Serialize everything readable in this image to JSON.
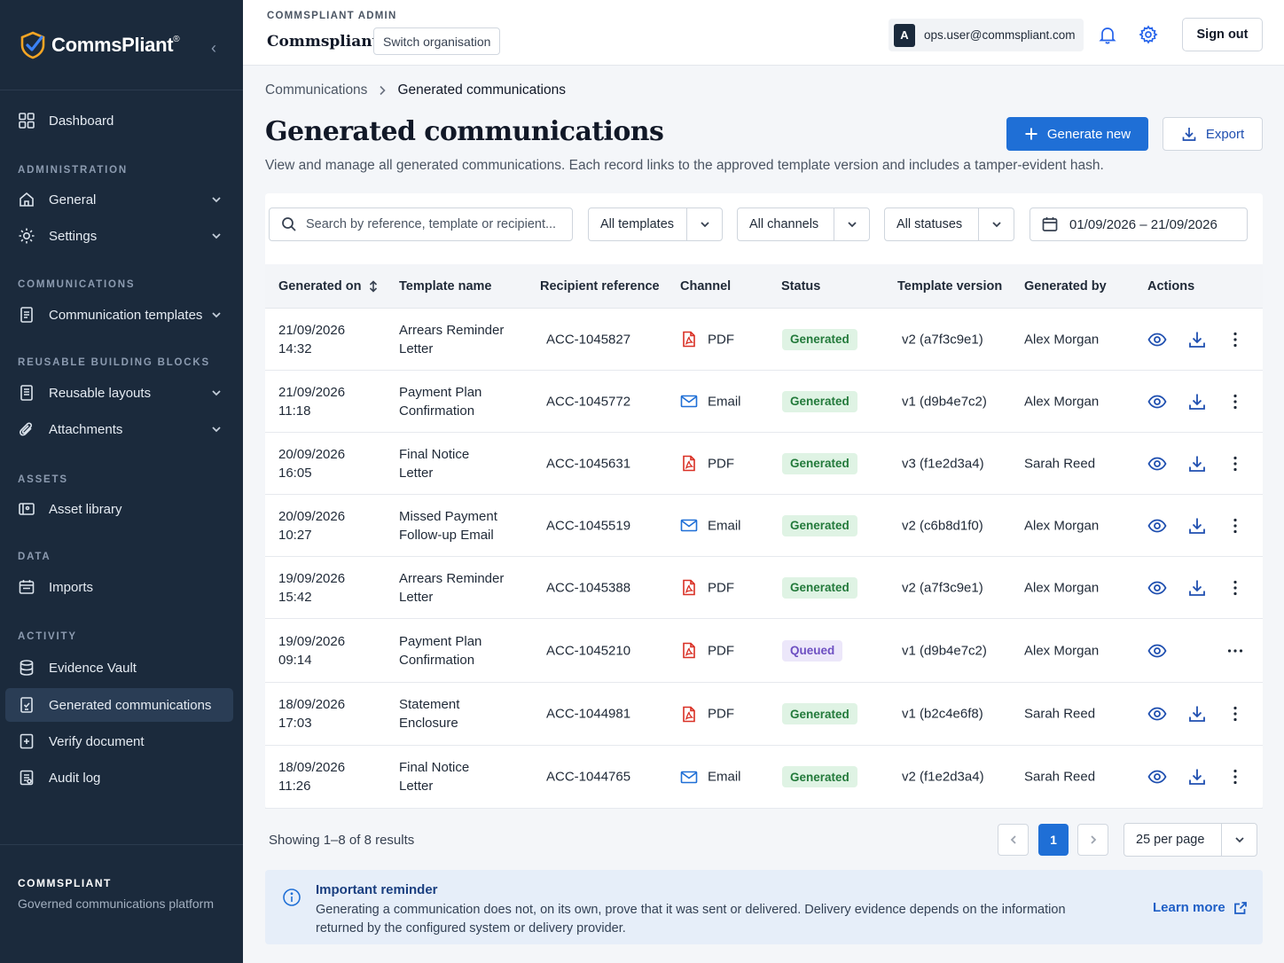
{
  "brand": {
    "name": "CommsPliant",
    "registered": "®"
  },
  "sidebar": {
    "dashboard": "Dashboard",
    "sections": {
      "administration": "ADMINISTRATION",
      "communications": "COMMUNICATIONS",
      "building_blocks": "REUSABLE BUILDING BLOCKS",
      "assets": "ASSETS",
      "data": "DATA",
      "activity": "ACTIVITY"
    },
    "items": {
      "general": "General",
      "settings": "Settings",
      "templates": "Communication templates",
      "layouts": "Reusable layouts",
      "attachments": "Attachments",
      "asset_library": "Asset library",
      "imports": "Imports",
      "evidence_vault": "Evidence Vault",
      "generated": "Generated communications",
      "verify": "Verify document",
      "audit": "Audit log"
    },
    "footer": {
      "title": "COMMSPLIANT",
      "subtitle": "Governed communications platform"
    }
  },
  "header": {
    "admin_label": "COMMSPLIANT ADMIN",
    "org_name": "Commspliant",
    "switch_org": "Switch organisation",
    "user_initial": "A",
    "user_email": "ops.user@commspliant.com",
    "sign_out": "Sign out"
  },
  "breadcrumb": {
    "parent": "Communications",
    "current": "Generated communications"
  },
  "page": {
    "title": "Generated communications",
    "subtitle": "View and manage all generated communications. Each record links to the approved template version and includes a tamper-evident hash.",
    "generate_new": "Generate new",
    "export": "Export"
  },
  "filters": {
    "search_placeholder": "Search by reference, template or recipient...",
    "templates": "All templates",
    "channels": "All channels",
    "statuses": "All statuses",
    "date_range": "01/09/2026 – 21/09/2026"
  },
  "table": {
    "columns": [
      "Generated on",
      "Template name",
      "Recipient reference",
      "Channel",
      "Status",
      "Template version",
      "Generated by",
      "Actions"
    ],
    "rows": [
      {
        "date": "21/09/2026",
        "time": "14:32",
        "t1": "Arrears Reminder",
        "t2": "Letter",
        "ref": "ACC-1045827",
        "channel": "PDF",
        "status": "Generated",
        "version": "v2 (a7f3c9e1)",
        "by": "Alex Morgan"
      },
      {
        "date": "21/09/2026",
        "time": "11:18",
        "t1": "Payment Plan",
        "t2": "Confirmation",
        "ref": "ACC-1045772",
        "channel": "Email",
        "status": "Generated",
        "version": "v1 (d9b4e7c2)",
        "by": "Alex Morgan"
      },
      {
        "date": "20/09/2026",
        "time": "16:05",
        "t1": "Final Notice",
        "t2": "Letter",
        "ref": "ACC-1045631",
        "channel": "PDF",
        "status": "Generated",
        "version": "v3 (f1e2d3a4)",
        "by": "Sarah Reed"
      },
      {
        "date": "20/09/2026",
        "time": "10:27",
        "t1": "Missed Payment",
        "t2": "Follow-up Email",
        "ref": "ACC-1045519",
        "channel": "Email",
        "status": "Generated",
        "version": "v2 (c6b8d1f0)",
        "by": "Alex Morgan"
      },
      {
        "date": "19/09/2026",
        "time": "15:42",
        "t1": "Arrears Reminder",
        "t2": "Letter",
        "ref": "ACC-1045388",
        "channel": "PDF",
        "status": "Generated",
        "version": "v2 (a7f3c9e1)",
        "by": "Alex Morgan"
      },
      {
        "date": "19/09/2026",
        "time": "09:14",
        "t1": "Payment Plan",
        "t2": "Confirmation",
        "ref": "ACC-1045210",
        "channel": "PDF",
        "status": "Queued",
        "version": "v1 (d9b4e7c2)",
        "by": "Alex Morgan"
      },
      {
        "date": "18/09/2026",
        "time": "17:03",
        "t1": "Statement",
        "t2": "Enclosure",
        "ref": "ACC-1044981",
        "channel": "PDF",
        "status": "Generated",
        "version": "v1 (b2c4e6f8)",
        "by": "Sarah Reed"
      },
      {
        "date": "18/09/2026",
        "time": "11:26",
        "t1": "Final Notice",
        "t2": "Letter",
        "ref": "ACC-1044765",
        "channel": "Email",
        "status": "Generated",
        "version": "v2 (f1e2d3a4)",
        "by": "Sarah Reed"
      }
    ]
  },
  "pagination": {
    "summary": "Showing 1–8 of 8 results",
    "current_page": "1",
    "per_page": "25 per page"
  },
  "notice": {
    "title": "Important reminder",
    "body": "Generating a communication does not, on its own, prove that it was sent or delivered. Delivery evidence depends on the information returned by the configured system or delivery provider.",
    "link": "Learn more"
  },
  "colors": {
    "sidebar_bg": "#1b2a3c",
    "primary": "#1f6fd6",
    "generated_bg": "#dff3e4",
    "queued_bg": "#ece7fa",
    "pdf_red": "#d93025"
  },
  "icons": [
    "dashboard-icon",
    "home-icon",
    "gear-icon",
    "document-icon",
    "layout-icon",
    "paperclip-icon",
    "image-icon",
    "calendar-icon",
    "database-icon",
    "file-check-icon",
    "file-plus-icon",
    "clipboard-icon",
    "bell-icon",
    "search-icon",
    "eye-icon",
    "download-icon",
    "kebab-icon",
    "pdf-icon",
    "email-icon",
    "info-icon",
    "external-link-icon"
  ]
}
